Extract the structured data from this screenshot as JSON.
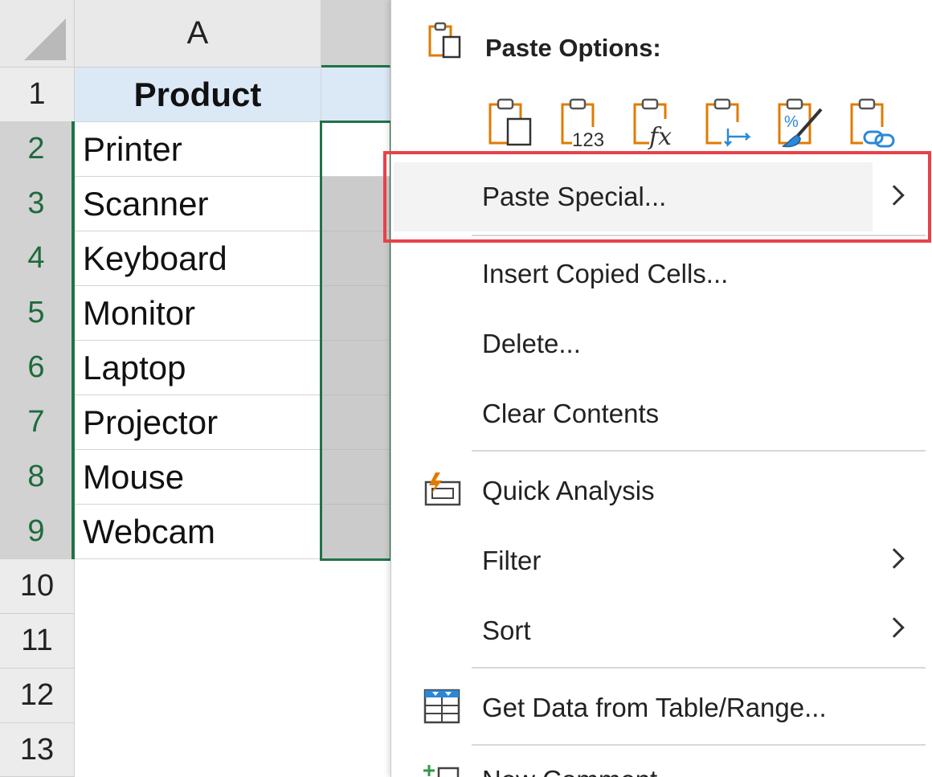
{
  "sheet": {
    "column_headers": [
      "A"
    ],
    "row_numbers": [
      "1",
      "2",
      "3",
      "4",
      "5",
      "6",
      "7",
      "8",
      "9",
      "10",
      "11",
      "12",
      "13"
    ],
    "header_cell": "Product",
    "products": [
      "Printer",
      "Scanner",
      "Keyboard",
      "Monitor",
      "Laptop",
      "Projector",
      "Mouse",
      "Webcam"
    ]
  },
  "context_menu": {
    "paste_options_label": "Paste Options:",
    "paste_buttons": [
      "paste-icon",
      "paste-values-icon",
      "paste-formulas-icon",
      "paste-transpose-icon",
      "paste-formatting-icon",
      "paste-link-icon"
    ],
    "paste_special": "Paste Special...",
    "insert_copied_cells": "Insert Copied Cells...",
    "delete": "Delete...",
    "clear_contents": "Clear Contents",
    "quick_analysis": "Quick Analysis",
    "filter": "Filter",
    "sort": "Sort",
    "get_data": "Get Data from Table/Range...",
    "new_comment": "New Comment"
  },
  "colors": {
    "selection_green": "#217346",
    "highlight_red": "#e8414a",
    "header_fill": "#dbe8f6",
    "icon_orange": "#e07b00",
    "icon_blue": "#2b88d8"
  }
}
